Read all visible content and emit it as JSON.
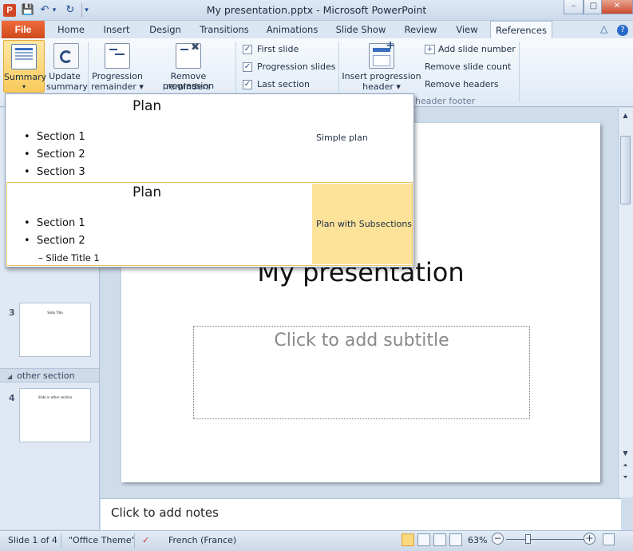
{
  "window": {
    "title": "My presentation.pptx - Microsoft PowerPoint",
    "app_icon_letter": "P",
    "controls": {
      "minimize": "–",
      "maximize": "□",
      "close": "✕"
    }
  },
  "qat": {
    "save": "💾",
    "undo": "↶",
    "undo_dropdown": "▾",
    "redo": "↻",
    "customize": "▾"
  },
  "tabs": [
    "File",
    "Home",
    "Insert",
    "Design",
    "Transitions",
    "Animations",
    "Slide Show",
    "Review",
    "View",
    "References"
  ],
  "active_tab": "References",
  "help": {
    "minimize_ribbon": "△",
    "help": "?"
  },
  "ribbon": {
    "summary": {
      "label": "Summary",
      "arrow": "▾"
    },
    "update_summary": {
      "line1": "Update",
      "line2": "summary"
    },
    "progression_remainder": {
      "line1": "Progression",
      "line2": "remainder ▾"
    },
    "remove_progression_reminders": {
      "line1": "Remove progression",
      "line2": "reminders"
    },
    "checkboxes": [
      {
        "label": "First slide",
        "checked": true
      },
      {
        "label": "Progression slides",
        "checked": true
      },
      {
        "label": "Last section",
        "checked": true
      }
    ],
    "insert_progression_header": {
      "line1": "Insert progression",
      "line2": "header ▾"
    },
    "header_footer_links": {
      "add_slide_number": "Add slide number",
      "remove_slide_count": "Remove slide count",
      "remove_headers": "Remove headers"
    },
    "group_label": "header  footer"
  },
  "gallery": {
    "item1": {
      "title": "Plan",
      "bullets": [
        "Section 1",
        "Section 2",
        "Section 3"
      ],
      "label": "Simple plan"
    },
    "item2": {
      "title": "Plan",
      "bullets": [
        "Section 1",
        "Section 2"
      ],
      "sub_bullet": "– Slide Title 1",
      "label": "Plan with Subsections"
    }
  },
  "slide_pane": {
    "slides": [
      {
        "number": "3",
        "text": "Slide Title"
      },
      {
        "number": "4",
        "text": "Slide in other section"
      }
    ],
    "section_header": {
      "arrow": "◢",
      "name": "other section"
    }
  },
  "slide": {
    "title": "My presentation",
    "subtitle_placeholder": "Click to add subtitle"
  },
  "notes": {
    "placeholder": "Click to add notes"
  },
  "status": {
    "slide_info": "Slide 1 of 4",
    "theme": "\"Office Theme\"",
    "language": "French (France)",
    "zoom": "63%",
    "zoom_percent": 63
  },
  "colors": {
    "accent_file_tab": "#e8612c",
    "highlight": "#fde29a",
    "ribbon_bg": "#e7eff8"
  }
}
